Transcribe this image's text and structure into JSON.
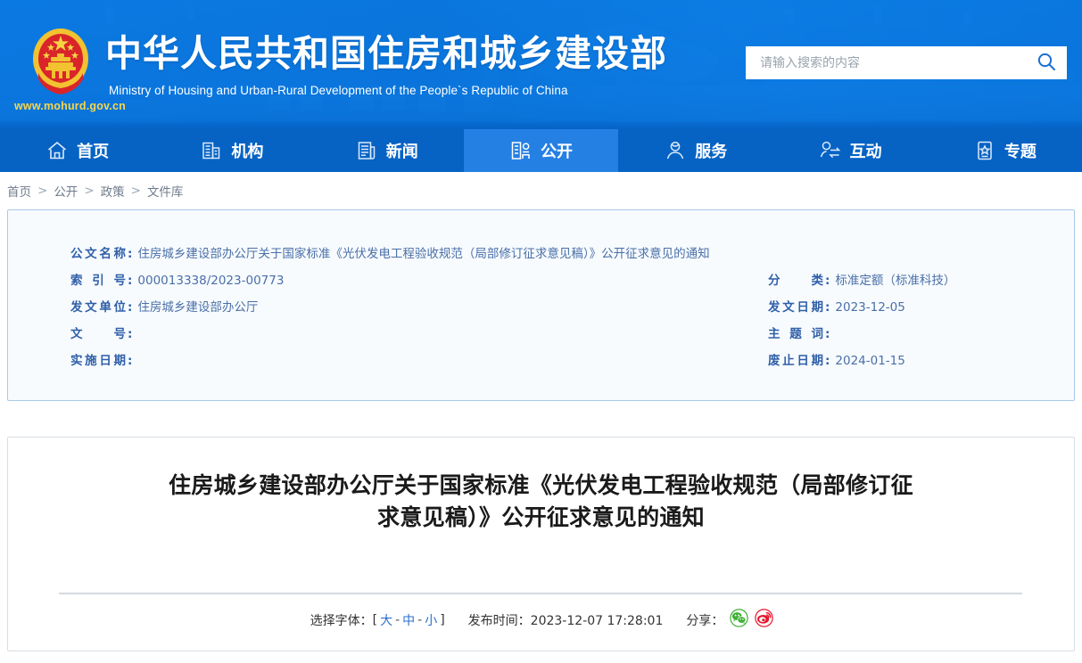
{
  "header": {
    "emblem_icon": "china-national-emblem",
    "site_url": "www.mohurd.gov.cn",
    "title_cn": "中华人民共和国住房和城乡建设部",
    "title_en": "Ministry of Housing and Urban-Rural Development of the People`s Republic of China",
    "search": {
      "placeholder": "请输入搜索的内容",
      "value": "",
      "icon": "search-icon"
    },
    "brand_blue": "#0a78e0",
    "nav_blue": "#0663c4",
    "nav_active_blue": "#2580e4"
  },
  "nav": {
    "items": [
      {
        "label": "首页",
        "icon": "home-icon",
        "active": false
      },
      {
        "label": "机构",
        "icon": "building-icon",
        "active": false
      },
      {
        "label": "新闻",
        "icon": "news-icon",
        "active": false
      },
      {
        "label": "公开",
        "icon": "disclosure-icon",
        "active": true
      },
      {
        "label": "服务",
        "icon": "service-user-icon",
        "active": false
      },
      {
        "label": "互动",
        "icon": "interaction-icon",
        "active": false
      },
      {
        "label": "专题",
        "icon": "star-topic-icon",
        "active": false
      }
    ]
  },
  "breadcrumb": {
    "items": [
      "首页",
      "公开",
      "政策",
      "文件库"
    ],
    "separator": ">"
  },
  "meta": {
    "left": [
      {
        "label": "公文名称",
        "value": "住房城乡建设部办公厅关于国家标准《光伏发电工程验收规范（局部修订征求意见稿）》公开征求意见的通知"
      },
      {
        "label": "索引号",
        "value": "000013338/2023-00773"
      },
      {
        "label": "发文单位",
        "value": "住房城乡建设部办公厅"
      },
      {
        "label": "文号",
        "value": ""
      },
      {
        "label": "实施日期",
        "value": ""
      }
    ],
    "right": [
      {
        "label": "分类",
        "value": "标准定额（标准科技）"
      },
      {
        "label": "发文日期",
        "value": "2023-12-05"
      },
      {
        "label": "主题词",
        "value": ""
      },
      {
        "label": "废止日期",
        "value": "2024-01-15"
      }
    ]
  },
  "article": {
    "title": "住房城乡建设部办公厅关于国家标准《光伏发电工程验收规范（局部修订征求意见稿）》公开征求意见的通知",
    "toolbar": {
      "fontsize_label": "选择字体：",
      "bracket_open": "[",
      "bracket_close": "]",
      "dash": "-",
      "fontsize_options": [
        "大",
        "中",
        "小"
      ],
      "publish_label": "发布时间：",
      "publish_time": "2023-12-07 17:28:01",
      "share_label": "分享：",
      "share_icons": [
        {
          "name": "wechat-share-icon",
          "color": "#3eb135"
        },
        {
          "name": "weibo-share-icon",
          "color": "#e6162d"
        }
      ]
    }
  }
}
